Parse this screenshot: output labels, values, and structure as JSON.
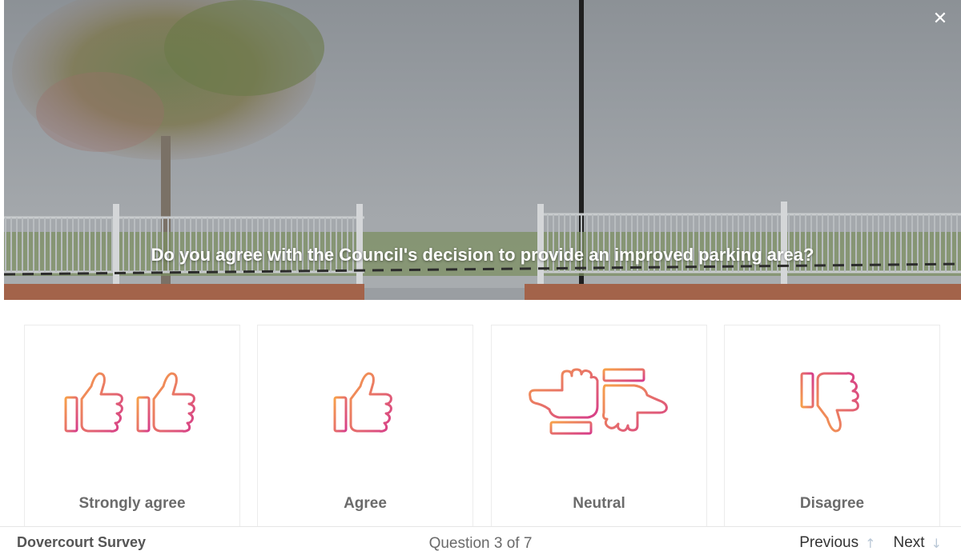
{
  "hero": {
    "question": "Do you agree with the Council's decision to provide an improved parking area?",
    "close_icon": "close-icon"
  },
  "options": [
    {
      "label": "Strongly agree",
      "icon": "double-thumbs-up-icon"
    },
    {
      "label": "Agree",
      "icon": "thumbs-up-icon"
    },
    {
      "label": "Neutral",
      "icon": "sideways-hands-icon"
    },
    {
      "label": "Disagree",
      "icon": "thumbs-down-icon"
    }
  ],
  "footer": {
    "brand": "Dovercourt Survey",
    "progress": "Question 3 of 7",
    "previous_label": "Previous",
    "next_label": "Next",
    "previous_icon": "arrow-up-icon",
    "next_icon": "arrow-down-icon"
  },
  "colors": {
    "icon_gradient_start": "#f7a14a",
    "icon_gradient_end": "#d63d8a",
    "close": "#ffffff"
  }
}
